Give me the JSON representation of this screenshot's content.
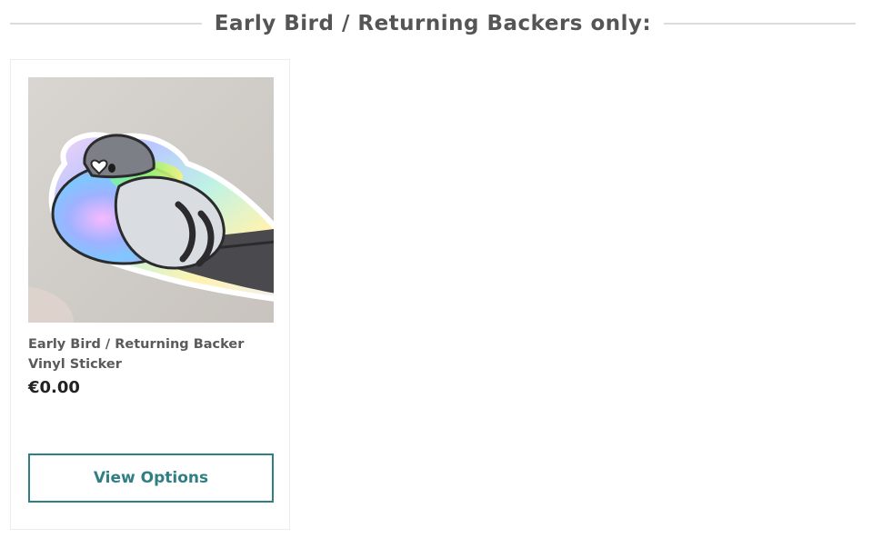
{
  "section": {
    "title": "Early Bird / Returning Backers only:"
  },
  "product": {
    "name": "Early Bird / Returning Backer Vinyl Sticker",
    "price": "€0.00",
    "image_icon": "pigeon-sticker-image",
    "button_label": "View Options"
  },
  "colors": {
    "accent": "#2f7f84",
    "heading_text": "#555555",
    "divider": "#dcdcdc",
    "card_border": "#ececec"
  }
}
